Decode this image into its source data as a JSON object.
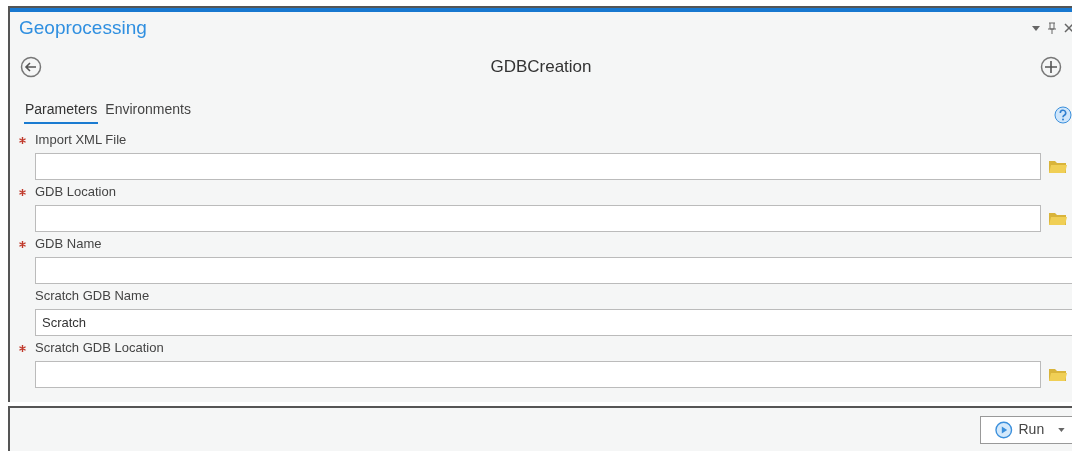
{
  "pane": {
    "title": "Geoprocessing"
  },
  "tool": {
    "title": "GDBCreation"
  },
  "tabs": [
    {
      "label": "Parameters",
      "selected": true
    },
    {
      "label": "Environments",
      "selected": false
    }
  ],
  "parameters": [
    {
      "label": "Import XML File",
      "required": true,
      "kind": "browse"
    },
    {
      "label": "GDB Location",
      "required": true,
      "kind": "browse"
    },
    {
      "label": "GDB Name",
      "required": true,
      "kind": "text"
    },
    {
      "label": "Scratch GDB Name",
      "required": false,
      "kind": "text",
      "value": "Scratch"
    },
    {
      "label": "Scratch GDB Location",
      "required": true,
      "kind": "browse"
    }
  ],
  "run_button": {
    "label": "Run"
  }
}
